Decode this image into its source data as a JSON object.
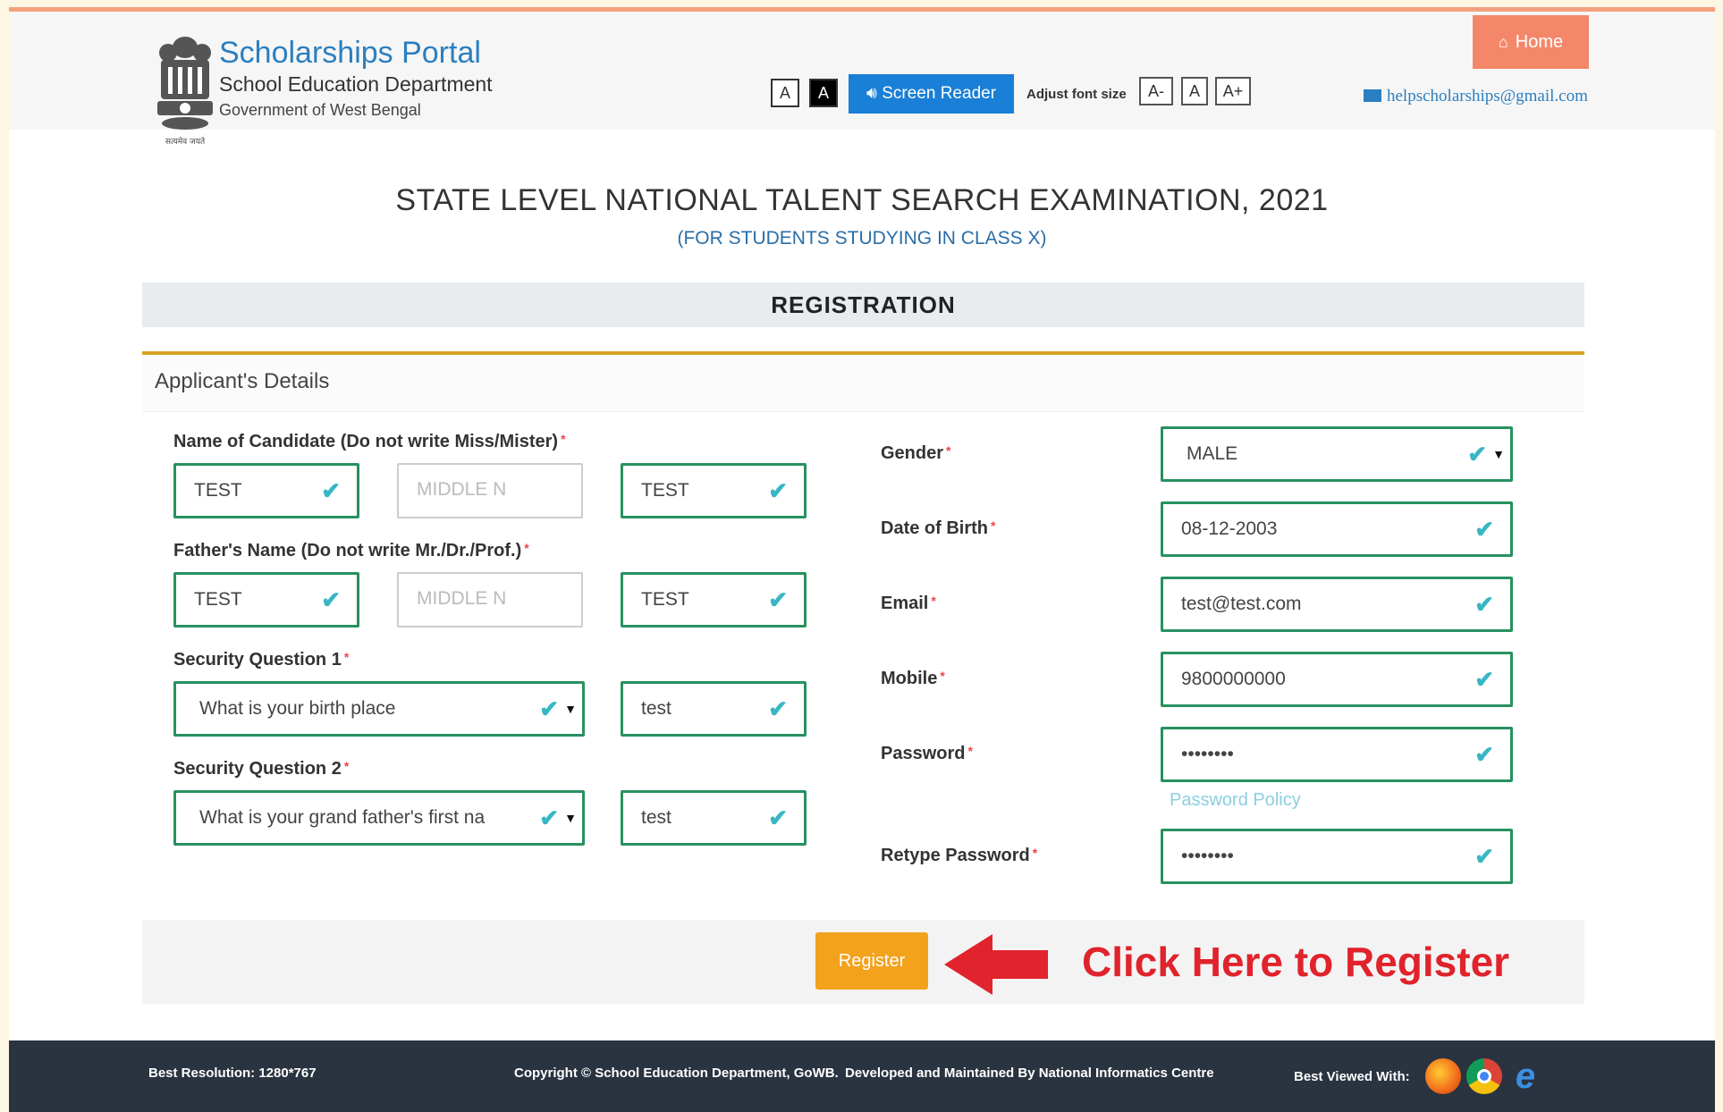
{
  "header": {
    "portal_title": "Scholarships Portal",
    "department": "School Education Department",
    "government": "Government of West Bengal",
    "emblem_caption": "सत्यमेव जयते",
    "contrast_light": "A",
    "contrast_dark": "A",
    "screen_reader": "Screen Reader",
    "adjust_font_label": "Adjust font size",
    "font_decrease": "A-",
    "font_normal": "A",
    "font_increase": "A+",
    "home": "Home",
    "email": "helpscholarships@gmail.com"
  },
  "page": {
    "title": "STATE LEVEL NATIONAL TALENT SEARCH EXAMINATION, 2021",
    "subtitle": "(FOR STUDENTS STUDYING IN CLASS X)",
    "section": "REGISTRATION",
    "panel_title": "Applicant's Details"
  },
  "form": {
    "candidate_name_label": "Name of Candidate (Do not write Miss/Mister)",
    "candidate_first": "TEST",
    "candidate_middle_placeholder": "MIDDLE N",
    "candidate_last": "TEST",
    "father_name_label": "Father's Name (Do not write Mr./Dr./Prof.)",
    "father_first": "TEST",
    "father_middle_placeholder": "MIDDLE N",
    "father_last": "TEST",
    "sq1_label": "Security Question 1",
    "sq1_question": "What is your birth place",
    "sq1_answer": "test",
    "sq2_label": "Security Question 2",
    "sq2_question": "What is your grand father's first na",
    "sq2_answer": "test",
    "gender_label": "Gender",
    "gender_value": "MALE",
    "dob_label": "Date of Birth",
    "dob_value": "08-12-2003",
    "email_label": "Email",
    "email_value": "test@test.com",
    "mobile_label": "Mobile",
    "mobile_value": "9800000000",
    "password_label": "Password",
    "password_value": "••••••••",
    "password_policy": "Password Policy",
    "retype_label": "Retype Password",
    "retype_value": "••••••••",
    "register": "Register",
    "annotation": "Click Here to Register"
  },
  "footer": {
    "resolution": "Best Resolution: 1280*767",
    "copyright": "Copyright © School Education Department, GoWB.",
    "developed": "Developed and Maintained By National Informatics Centre",
    "best_viewed": "Best Viewed With:"
  },
  "colors": {
    "accent_blue": "#2a7fc0",
    "valid_border": "#27915f",
    "home_button": "#f4876a",
    "register_button": "#f3a21c",
    "annotation_red": "#e0232c"
  }
}
